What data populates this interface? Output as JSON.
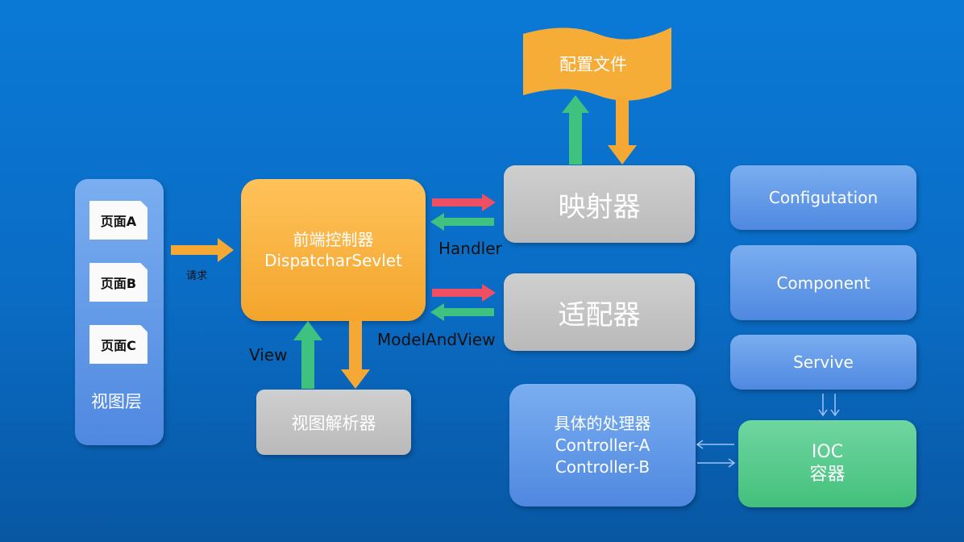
{
  "view_layer": {
    "label": "视图层",
    "pages": [
      "页面A",
      "页面B",
      "页面C"
    ]
  },
  "request_label": "请求",
  "dispatcher": {
    "line1": "前端控制器",
    "line2": "DispatcharSevlet"
  },
  "mapper": "映射器",
  "adapter": "适配器",
  "config_file": "配置文件",
  "view_resolver": "视图解析器",
  "labels": {
    "handler": "Handler",
    "model_and_view": "ModelAndView",
    "view": "View"
  },
  "handler_box": {
    "line1": "具体的处理器",
    "line2": "Controller-A",
    "line3": "Controller-B"
  },
  "right_boxes": [
    "Configutation",
    "Component",
    "Servive"
  ],
  "ioc": {
    "line1": "IOC",
    "line2": "容器"
  },
  "colors": {
    "orange": "#f5a833",
    "green": "#3fc180",
    "red": "#ef4f63",
    "blue_box": "#5b93e4",
    "gray_box": "#c4c4c4",
    "ioc_green": "#4cc784"
  }
}
